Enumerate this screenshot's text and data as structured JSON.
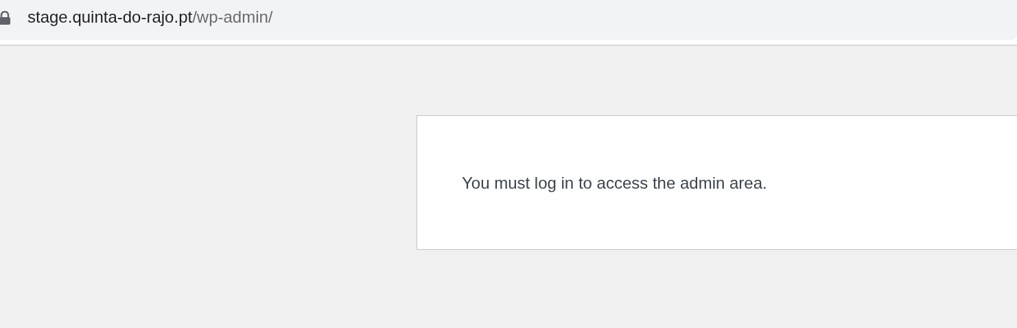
{
  "address_bar": {
    "host": "stage.quinta-do-rajo.pt",
    "path": "/wp-admin/"
  },
  "message": "You must log in to access the admin area."
}
